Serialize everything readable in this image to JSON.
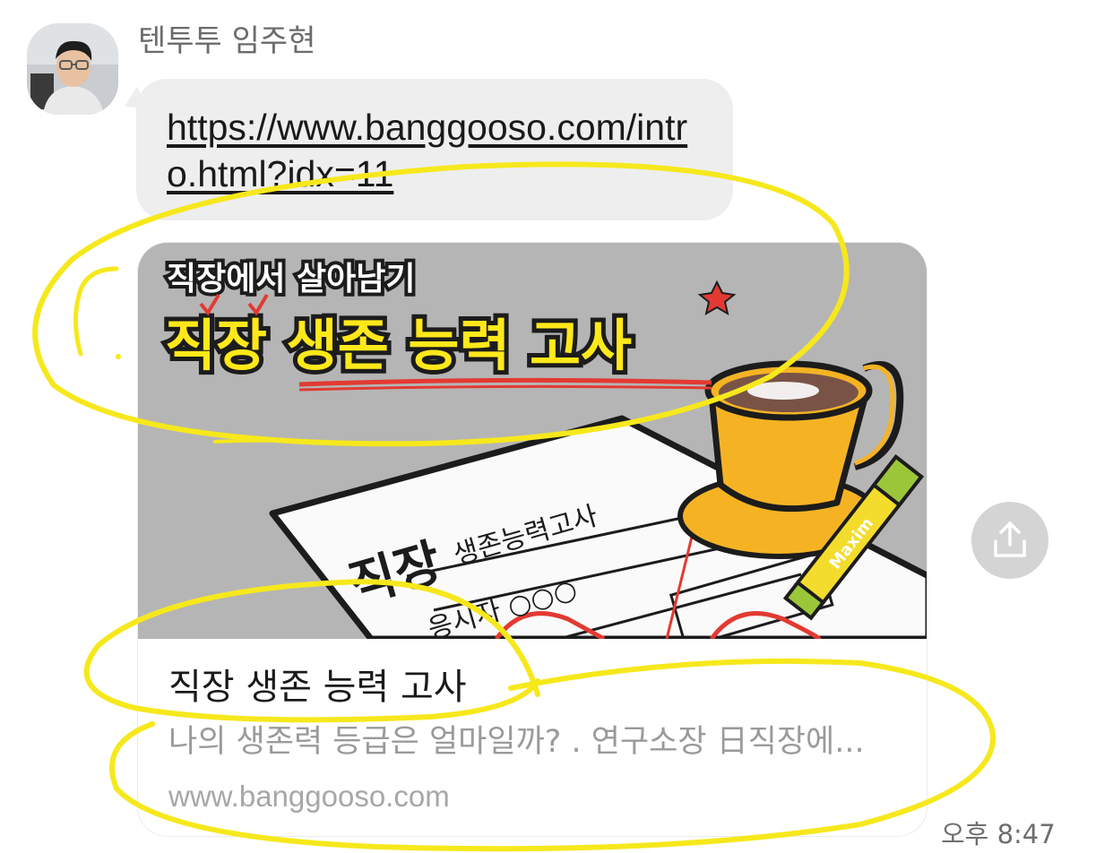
{
  "message": {
    "sender_name": "텐투투 임주현",
    "link_url": "https://www.banggooso.com/intro.html?idx=11",
    "timestamp": "오후 8:47"
  },
  "preview": {
    "thumbnail": {
      "subtitle": "직장에서 살아남기",
      "headline": "직장 생존 능력 고사",
      "paper_title_big": "직장",
      "paper_title_small": "생존능력고사",
      "paper_examinee": "응시자 ○○○",
      "stick_brand": "Maxim"
    },
    "title": "직장 생존 능력 고사",
    "description": "나의 생존력 등급은 얼마일까? . 연구소장 日직장에...",
    "domain": "www.banggooso.com"
  },
  "icons": {
    "share": "share-icon",
    "avatar": "avatar-photo"
  },
  "colors": {
    "bubble": "#eeeeee",
    "highlight_yellow": "#f6e81c",
    "headline_yellow": "#ffe81a",
    "cup_orange": "#f5b324"
  }
}
